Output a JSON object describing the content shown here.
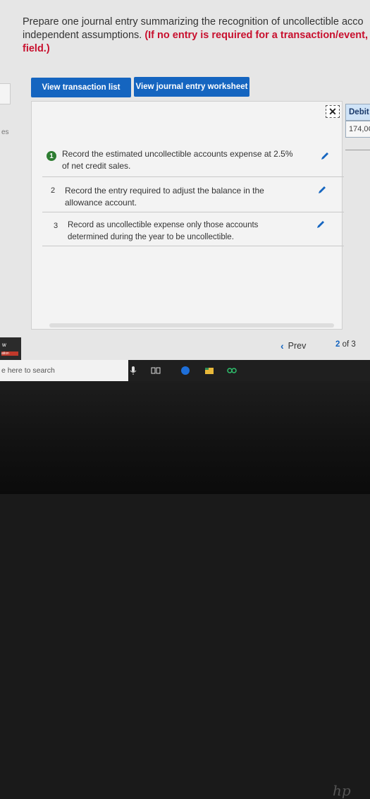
{
  "instructions": {
    "line1": "Prepare one journal entry summarizing the recognition of uncollectible acco",
    "line2_normal": "independent assumptions. ",
    "line2_red": "(If no entry is required for a transaction/event, s",
    "line3_red": "field.)"
  },
  "left_label": "es",
  "buttons": {
    "view_transaction_list": "View transaction list",
    "view_journal_worksheet": "View journal entry worksheet"
  },
  "debit": {
    "header": "Debit",
    "value": "174,0C"
  },
  "transactions": [
    {
      "number": "1",
      "text": "Record the estimated uncollectible accounts expense at 2.5% of net credit sales."
    },
    {
      "number": "2",
      "text": "Record the entry required to adjust the balance in the allowance account."
    },
    {
      "number": "3",
      "text": "Record as uncollectible expense only those accounts determined during the year to be uncollectible."
    }
  ],
  "nav": {
    "prev_label": "Prev",
    "page_current": "2",
    "page_of": "of",
    "page_total": "3"
  },
  "taskbar": {
    "search_placeholder": "e here to search"
  },
  "side_left": {
    "w": "w",
    "bar": "ation"
  },
  "colors": {
    "accent": "#1565c0",
    "red": "#c8102e",
    "green": "#2e7d32"
  },
  "icons": [
    "close-x-icon",
    "pencil-icon",
    "chevron-left-icon",
    "microphone-icon",
    "task-view-icon",
    "edge-icon",
    "file-explorer-icon",
    "app-icon",
    "hp-logo"
  ]
}
